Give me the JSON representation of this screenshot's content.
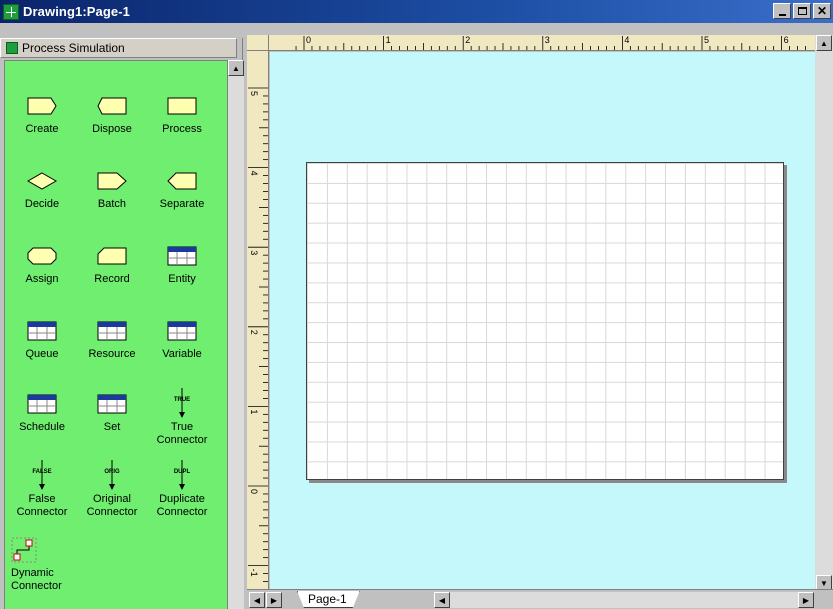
{
  "window": {
    "title": "Drawing1:Page-1"
  },
  "stencil": {
    "title": "Process Simulation",
    "masters": [
      {
        "label": "Create",
        "icon": "create-shape-icon"
      },
      {
        "label": "Dispose",
        "icon": "dispose-shape-icon"
      },
      {
        "label": "Process",
        "icon": "process-shape-icon"
      },
      {
        "label": "Decide",
        "icon": "decide-shape-icon"
      },
      {
        "label": "Batch",
        "icon": "batch-shape-icon"
      },
      {
        "label": "Separate",
        "icon": "separate-shape-icon"
      },
      {
        "label": "Assign",
        "icon": "assign-shape-icon"
      },
      {
        "label": "Record",
        "icon": "record-shape-icon"
      },
      {
        "label": "Entity",
        "icon": "table-icon"
      },
      {
        "label": "Queue",
        "icon": "table-icon"
      },
      {
        "label": "Resource",
        "icon": "table-icon"
      },
      {
        "label": "Variable",
        "icon": "table-icon"
      },
      {
        "label": "Schedule",
        "icon": "table-icon"
      },
      {
        "label": "Set",
        "icon": "table-icon"
      },
      {
        "label": "True Connector",
        "icon": "arrow-down-icon",
        "tag": "TRUE"
      },
      {
        "label": "False Connector",
        "icon": "arrow-down-icon",
        "tag": "FALSE"
      },
      {
        "label": "Original Connector",
        "icon": "arrow-down-icon",
        "tag": "ORIG"
      },
      {
        "label": "Duplicate Connector",
        "icon": "arrow-down-icon",
        "tag": "DUPL"
      },
      {
        "label": "Dynamic Connector",
        "icon": "dynamic-connector-icon"
      }
    ]
  },
  "rulers": {
    "horizontal": [
      "0",
      "1",
      "2",
      "3",
      "4",
      "5",
      "6"
    ],
    "vertical": [
      "5",
      "4",
      "3",
      "2",
      "1",
      "0",
      "-1"
    ]
  },
  "tabs": [
    {
      "label": "Page-1"
    }
  ],
  "colors": {
    "stencil_bg": "#6fee6f",
    "canvas_bg": "#c4f8fa",
    "titlebar": "#0a246a",
    "shape_fill": "#ffffb0"
  }
}
